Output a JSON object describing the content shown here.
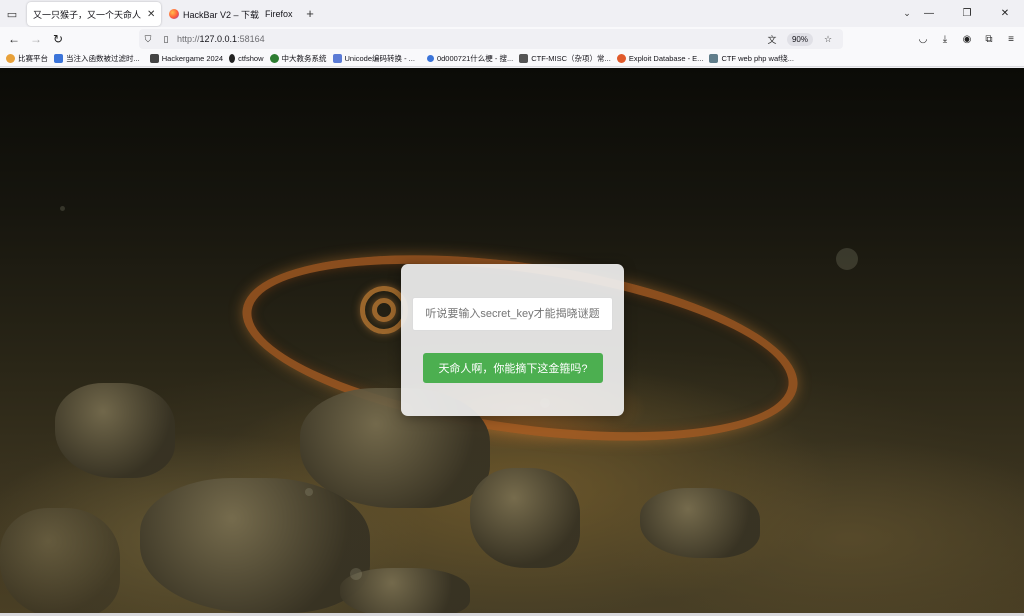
{
  "browser": {
    "tabs": [
      {
        "title": "又一只猴子，又一个天命人",
        "active": true
      },
      {
        "title": "HackBar V2 – 下载",
        "title_suffix": "Firefox",
        "active": false
      }
    ],
    "url": {
      "scheme": "http://",
      "host": "127.0.0.1",
      "port": ":58164"
    },
    "zoom": "90%",
    "bookmarks": [
      {
        "label": "比赛平台",
        "icon_color": "#e8a13a"
      },
      {
        "label": "当注入函数被过滤时...",
        "icon_color": "#3b74d9"
      },
      {
        "label": "Hackergame 2024",
        "icon_color": "#444444"
      },
      {
        "label": "ctfshow",
        "icon_color": "#222222"
      },
      {
        "label": "中大教务系统",
        "icon_color": "#2e7d32"
      },
      {
        "label": "Unicode编码转换 - ...",
        "icon_color": "#5b7bd5"
      },
      {
        "label": "0d000721什么梗 - 搜...",
        "icon_color": "#3b74d9"
      },
      {
        "label": "CTF-MISC（杂项）常...",
        "icon_color": "#555555"
      },
      {
        "label": "Exploit Database - E...",
        "icon_color": "#e05a2b"
      },
      {
        "label": "CTF web php waf绕...",
        "icon_color": "#607d8b"
      }
    ]
  },
  "page": {
    "input_placeholder": "听说要输入secret_key才能揭晓谜题",
    "button_label": "天命人啊，你能摘下这金箍吗?",
    "button_color": "#4caf50"
  }
}
